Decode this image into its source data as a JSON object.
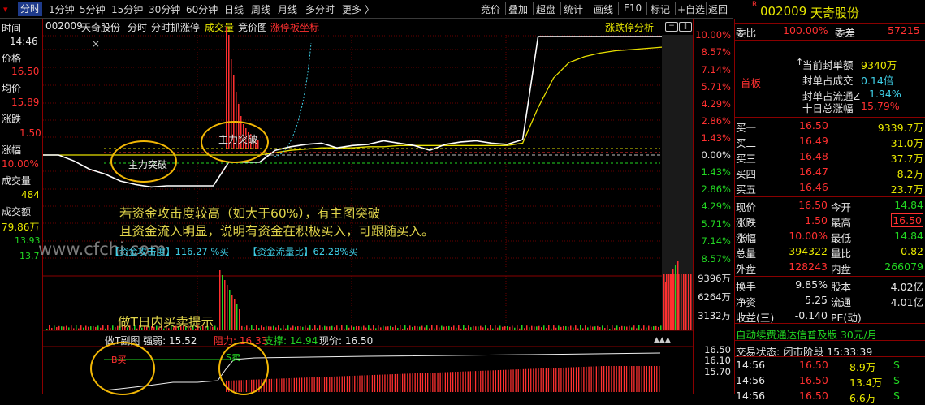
{
  "menubar": {
    "left": [
      "分时",
      "1分钟",
      "5分钟",
      "15分钟",
      "30分钟",
      "60分钟",
      "日线",
      "周线",
      "月线",
      "多分时",
      "更多 〉"
    ],
    "right": [
      "竞价",
      "叠加",
      "超盘",
      "统计",
      "画线",
      "F10",
      "标记",
      "+自选",
      "返回"
    ]
  },
  "left_panel": {
    "time_label": "时间",
    "time": "14:46",
    "price_label": "价格",
    "price": "16.50",
    "avg_label": "均价",
    "avg": "15.89",
    "chg_label": "涨跌",
    "chg": "1.50",
    "pct_label": "涨幅",
    "pct": "10.00%",
    "vol_label": "成交量",
    "vol": "484",
    "amt_label": "成交额",
    "amt": "79.86万",
    "extra1": "13.93",
    "extra2": "13.7"
  },
  "chart_header": {
    "code": "002009",
    "name": "天奇股份",
    "t1": "分时",
    "t2": "分时抓涨停",
    "t3": "成交量",
    "t4": "竞价图",
    "t5": "涨停板坐标",
    "right": "涨跌停分析"
  },
  "right_axis": {
    "pct_up": [
      "10.00%",
      "8.57%",
      "7.14%",
      "5.71%",
      "4.29%",
      "2.86%",
      "1.43%"
    ],
    "zero": "0.00%",
    "pct_down": [
      "1.43%",
      "2.86%",
      "4.29%",
      "5.71%",
      "7.14%",
      "8.57%"
    ],
    "vol": [
      "9396万",
      "6264万",
      "3132万"
    ],
    "lower": [
      "16.50",
      "16.10",
      "15.70"
    ]
  },
  "chart_data": {
    "type": "line",
    "xlabel": "",
    "ylabel": "",
    "ylim_pct": [
      -10,
      10
    ],
    "series": [
      {
        "name": "",
        "y_pct": [
          0,
          0,
          -0.5,
          -1.2,
          -1.6,
          -2.2,
          -2.5,
          -2.7,
          -2.6,
          -2.6,
          -2.6,
          -2.6,
          -0.6,
          -0.6,
          -0.6,
          0.4,
          0.7,
          0.9,
          1.0,
          0.6,
          0.8,
          0.9,
          1.2,
          1.0,
          0.8,
          0.4,
          0.9,
          1.1,
          1.2,
          1.0,
          0.9,
          1.3,
          10,
          10,
          10,
          10,
          10,
          10,
          10,
          10,
          10
        ]
      },
      {
        "name": "",
        "y_pct": [
          0,
          0,
          0,
          0,
          0,
          0,
          0,
          0,
          0,
          0,
          0,
          0,
          0,
          0,
          0,
          0.2,
          0.4,
          0.5,
          0.6,
          0.6,
          0.6,
          0.7,
          0.7,
          0.8,
          0.8,
          0.8,
          0.8,
          0.8,
          0.8,
          0.8,
          0.8,
          1.0,
          4.0,
          6.5,
          7.8,
          8.3,
          8.6,
          8.8,
          8.9,
          9.0,
          9.1
        ]
      }
    ],
    "annotations": [
      "主力突破",
      "主力突破"
    ]
  },
  "overlay": {
    "line1": "若资金攻击度较高（如大于60%），有主图突破",
    "line2": "且资金流入明显，说明有资金在积极买入，可跟随买入。",
    "watermark": "www.cfchi.com",
    "fund1_label": "【资金攻击度】116.27 %买",
    "fund2_label": "【资金流量比】62.28%买",
    "t_label": "做T日内买卖提示",
    "sub_title": "做T副图 强弱: 15.52",
    "sub_zl": "阻力: 16.33",
    "sub_zc": "支撑: 14.94",
    "sub_xj": "现价: 16.50",
    "buy_tag": "B买",
    "sell_tag": "S卖"
  },
  "info": {
    "code": "002009",
    "name": "天奇股份",
    "webi_label": "委比",
    "webi": "100.00%",
    "wecha_label": "委差",
    "wecha": "57215",
    "shouban": "首板",
    "seal_amount_label": "当前封单额",
    "seal_amount": "9340万",
    "seal_deal_label": "封单占成交",
    "seal_deal": "0.14倍",
    "seal_float_label": "封单占流通Z",
    "seal_float": "1.94%",
    "tenday_label": "十日总涨幅",
    "tenday": "15.79%",
    "orders": [
      {
        "label": "买一",
        "price": "16.50",
        "vol": "9339.7万"
      },
      {
        "label": "买二",
        "price": "16.49",
        "vol": "31.0万"
      },
      {
        "label": "买三",
        "price": "16.48",
        "vol": "37.7万"
      },
      {
        "label": "买四",
        "price": "16.47",
        "vol": "8.2万"
      },
      {
        "label": "买五",
        "price": "16.46",
        "vol": "23.7万"
      }
    ],
    "stats": [
      {
        "l1": "现价",
        "v1": "16.50",
        "l2": "今开",
        "v2": "14.84"
      },
      {
        "l1": "涨跌",
        "v1": "1.50",
        "l2": "最高",
        "v2": "16.50"
      },
      {
        "l1": "涨幅",
        "v1": "10.00%",
        "l2": "最低",
        "v2": "14.84"
      },
      {
        "l1": "总量",
        "v1": "394322",
        "l2": "量比",
        "v2": "0.82"
      },
      {
        "l1": "外盘",
        "v1": "128243",
        "l2": "内盘",
        "v2": "266079"
      }
    ],
    "stats2": [
      {
        "l1": "换手",
        "v1": "9.85%",
        "l2": "股本",
        "v2": "4.02亿"
      },
      {
        "l1": "净资",
        "v1": "5.25",
        "l2": "流通",
        "v2": "4.01亿"
      },
      {
        "l1": "收益(三)",
        "v1": "-0.140",
        "l2": "PE(动)",
        "v2": ""
      }
    ],
    "ad": "自动续费通达信普及版  30元/月",
    "status": "交易状态: 闭市阶段 15:33:39",
    "ticks": [
      {
        "t": "14:56",
        "p": "16.50",
        "v": "8.9万",
        "d": "S"
      },
      {
        "t": "14:56",
        "p": "16.50",
        "v": "13.4万",
        "d": "S"
      },
      {
        "t": "14:56",
        "p": "16.50",
        "v": "6.6万",
        "d": "S"
      }
    ]
  }
}
